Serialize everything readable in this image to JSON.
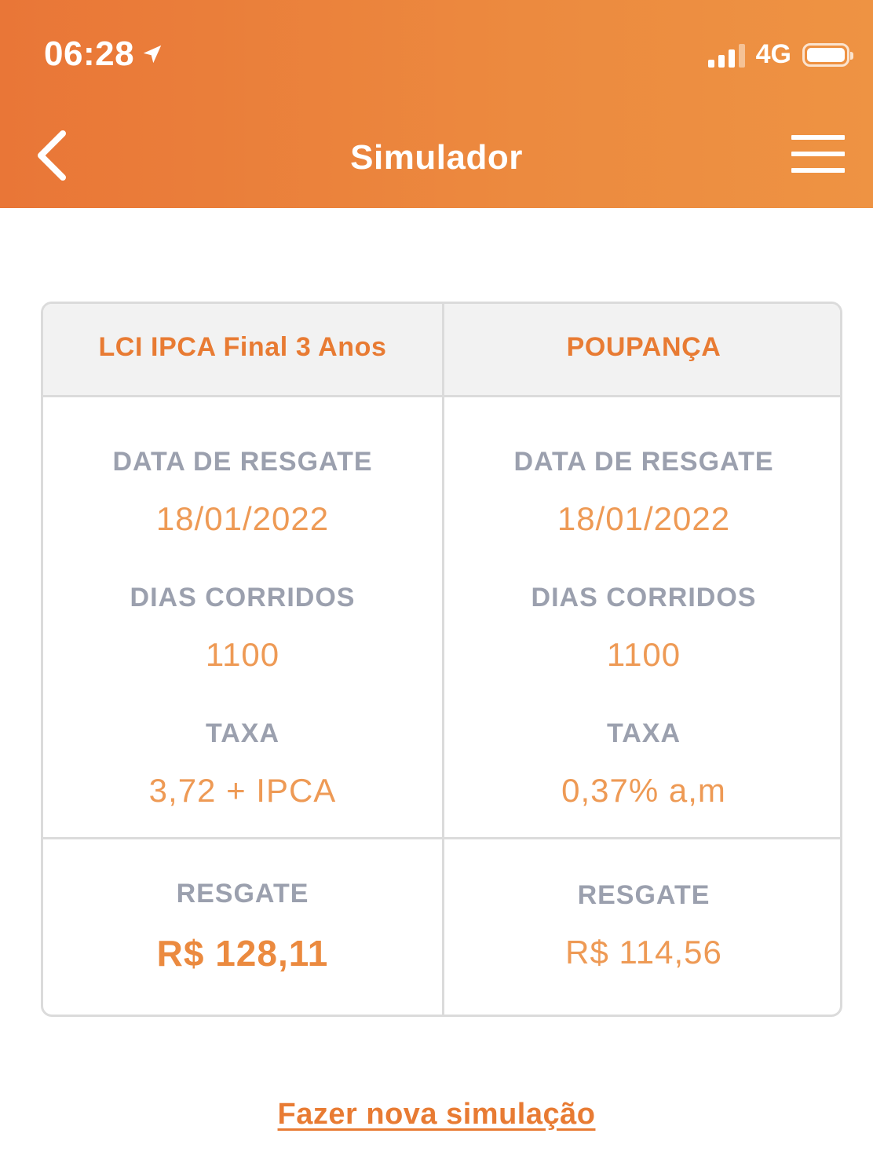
{
  "status_bar": {
    "time": "06:28",
    "network": "4G"
  },
  "header": {
    "title": "Simulador"
  },
  "columns": [
    {
      "title": "LCI IPCA Final 3 Anos",
      "data_label": "DATA DE RESGATE",
      "data_value": "18/01/2022",
      "dias_label": "DIAS CORRIDOS",
      "dias_value": "1100",
      "taxa_label": "TAXA",
      "taxa_value": "3,72 + IPCA",
      "resgate_label": "RESGATE",
      "resgate_value": "R$  128,11"
    },
    {
      "title": "POUPANÇA",
      "data_label": "DATA DE RESGATE",
      "data_value": "18/01/2022",
      "dias_label": "DIAS CORRIDOS",
      "dias_value": "1100",
      "taxa_label": "TAXA",
      "taxa_value": "0,37% a,m",
      "resgate_label": "RESGATE",
      "resgate_value": "R$  114,56"
    }
  ],
  "actions": {
    "new_simulation": "Fazer nova simulação"
  },
  "colors": {
    "accent": "#E87B33",
    "label": "#9BA0AE",
    "value": "#EE9A55",
    "border": "#DBDBDB"
  }
}
